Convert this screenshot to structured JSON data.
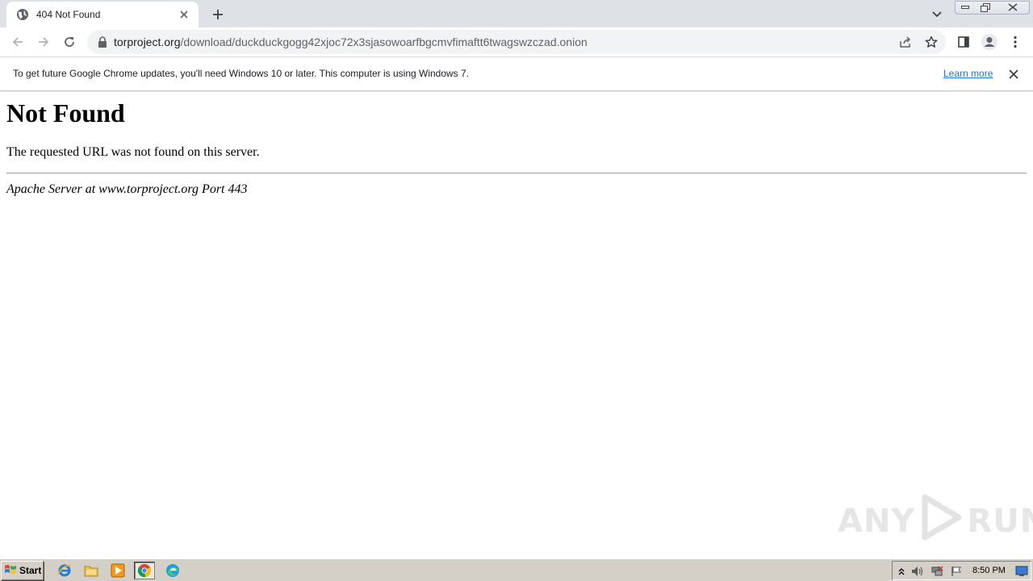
{
  "browser": {
    "tab": {
      "title": "404 Not Found",
      "favicon": "globe-icon"
    },
    "address_bar": {
      "host": "torproject.org",
      "path": "/download/duckduckgogg42xjoc72x3sjasowoarfbgcmvfimaftt6twagswzczad.onion"
    },
    "infobar": {
      "message": "To get future Google Chrome updates, you'll need Windows 10 or later. This computer is using Windows 7.",
      "link_label": "Learn more"
    }
  },
  "page": {
    "heading": "Not Found",
    "message": "The requested URL was not found on this server.",
    "signature": "Apache Server at www.torproject.org Port 443"
  },
  "watermark": {
    "left": "ANY",
    "right": "RUN"
  },
  "taskbar": {
    "start_label": "Start",
    "pinned": [
      "internet-explorer-icon",
      "file-explorer-icon",
      "media-player-icon",
      "chrome-icon",
      "edge-icon"
    ],
    "clock": "8:50 PM"
  },
  "colors": {
    "tabstrip": "#dee1e6",
    "omnibox": "#f1f3f4",
    "link": "#1a73e8",
    "taskbar": "#d4d0c8"
  }
}
